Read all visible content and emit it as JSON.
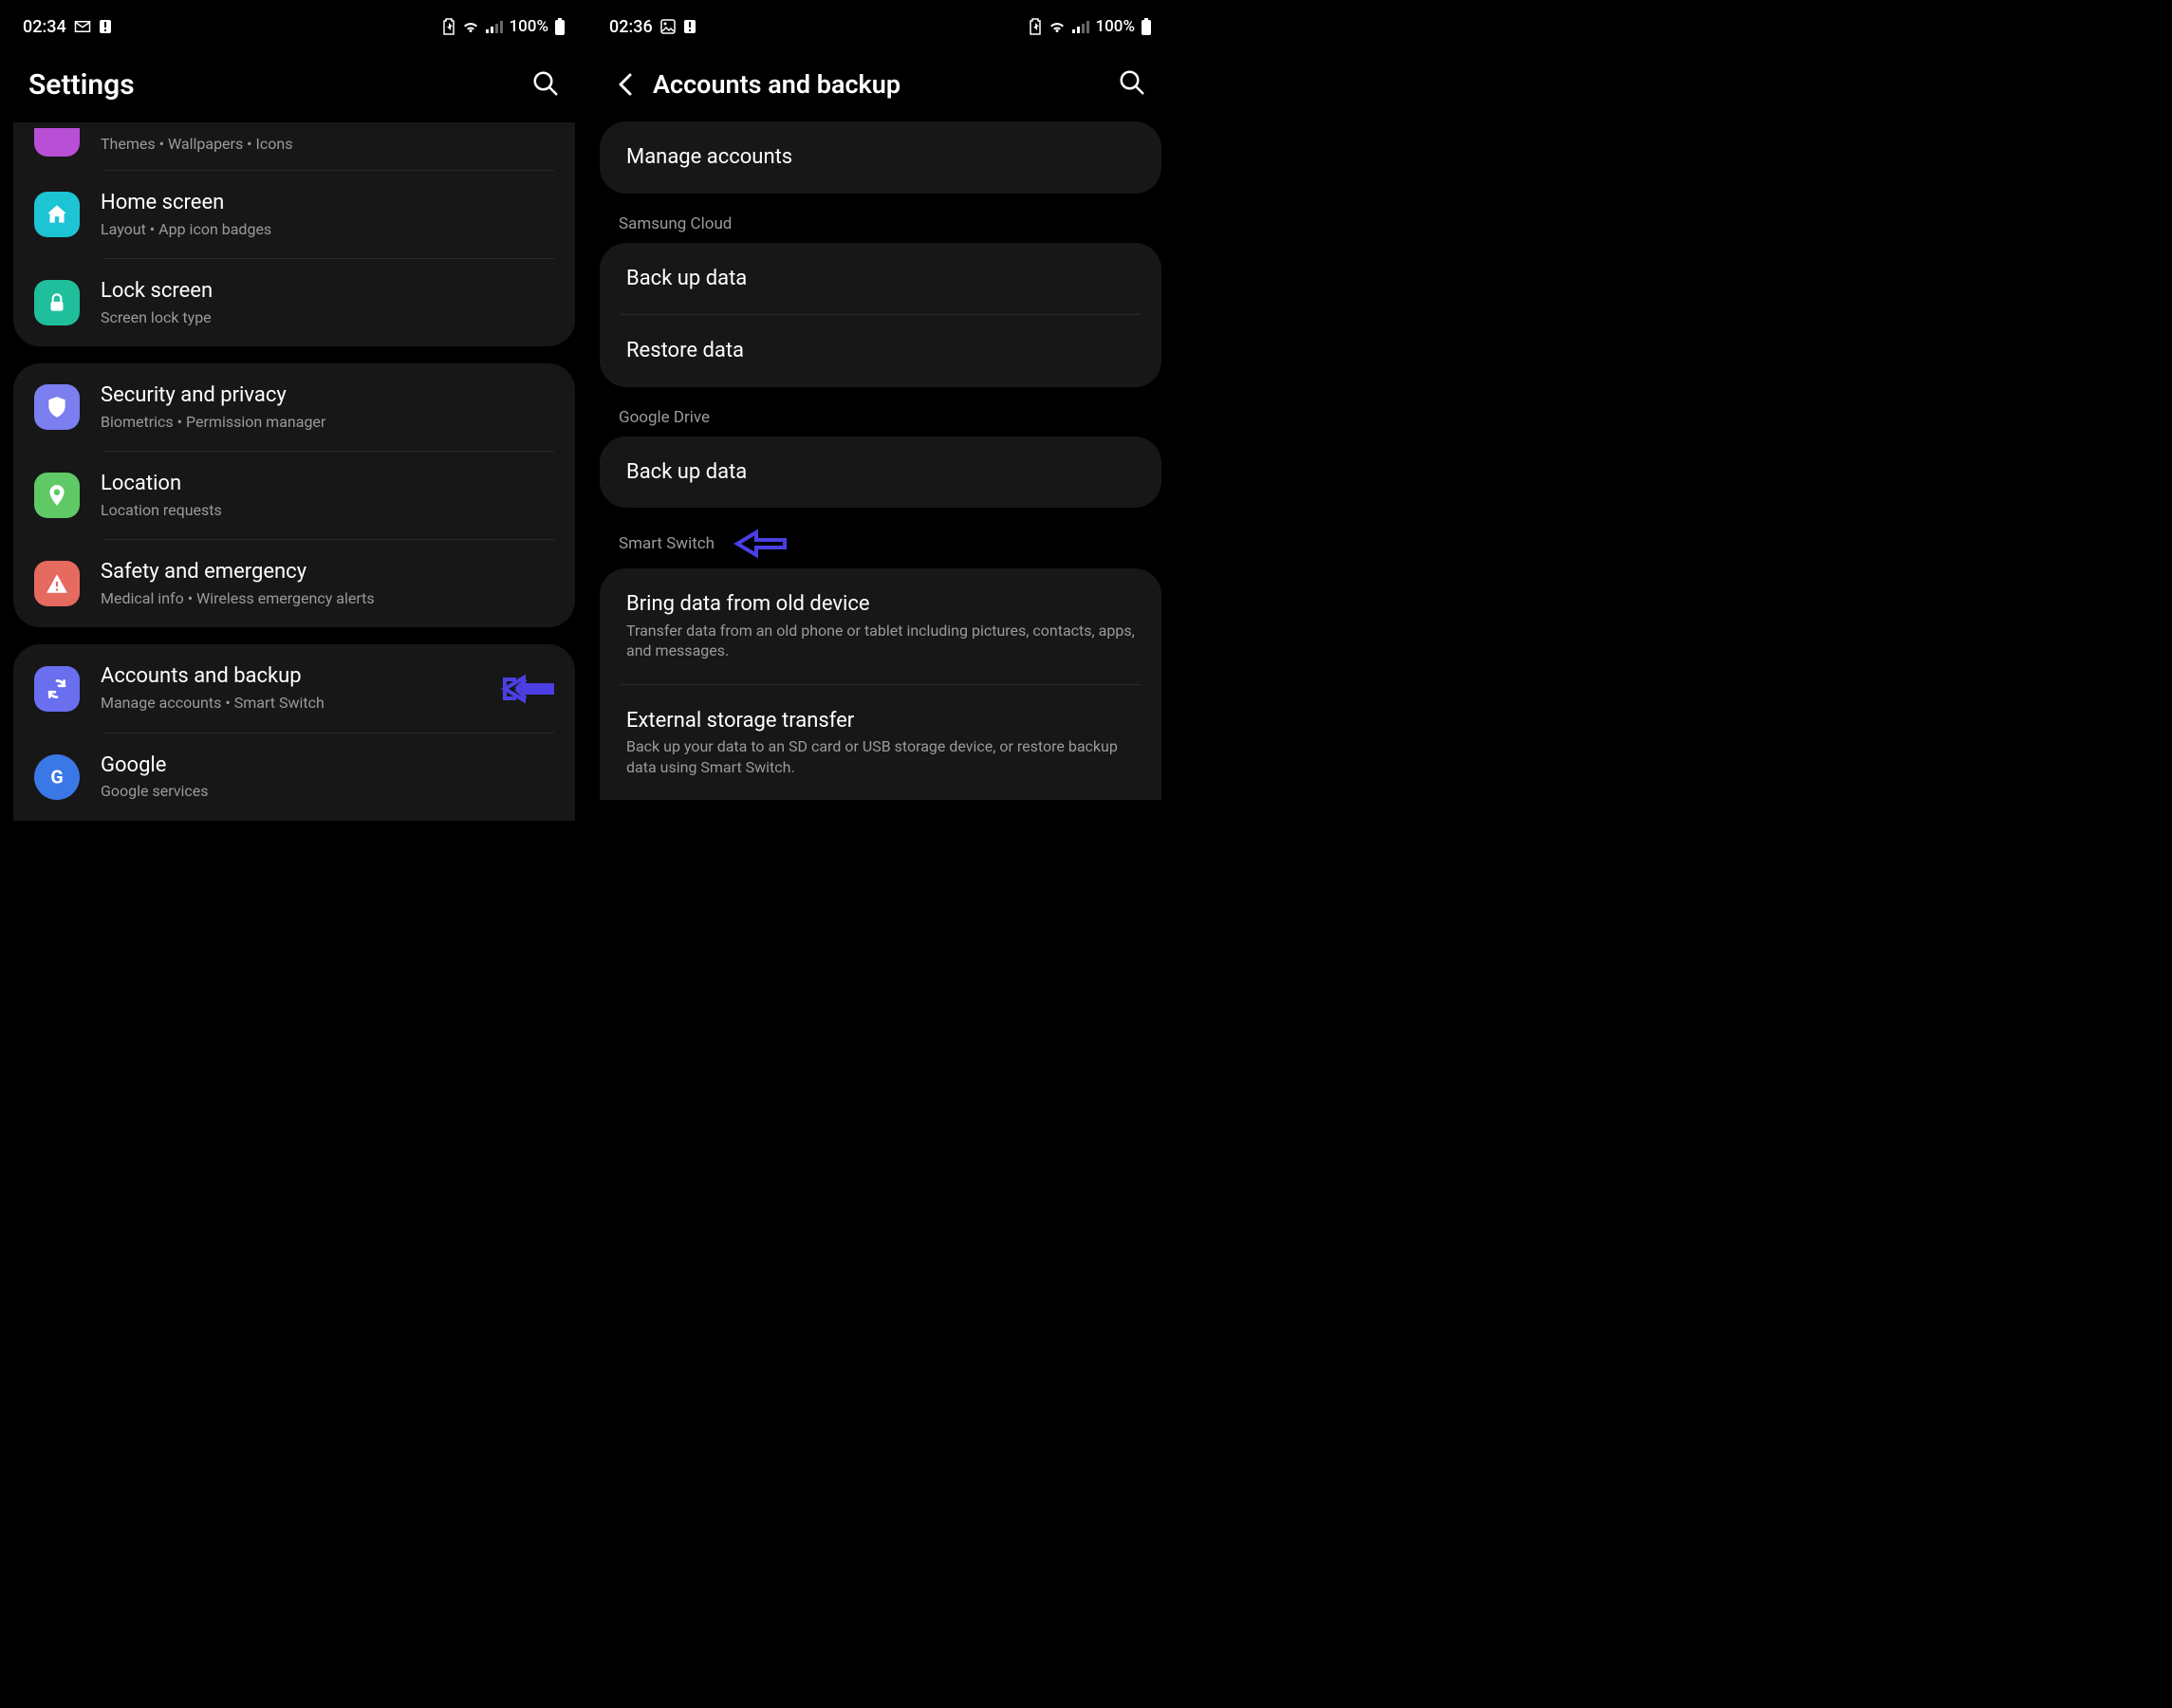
{
  "left": {
    "status": {
      "time": "02:34",
      "battery_pct": "100%"
    },
    "header": {
      "title": "Settings"
    },
    "icon_colors": {
      "themes": "#b84fd6",
      "home": "#1cc4d4",
      "lock": "#1fbf9c",
      "security": "#7b7ff0",
      "location": "#5fc965",
      "safety": "#e66a5f",
      "accounts": "#6a6ff0",
      "google": "#3b78e7"
    },
    "group0": {
      "themes": {
        "sub": "Themes  •  Wallpapers  •  Icons"
      },
      "home": {
        "title": "Home screen",
        "sub": "Layout  •  App icon badges"
      },
      "lock": {
        "title": "Lock screen",
        "sub": "Screen lock type"
      }
    },
    "group1": {
      "security": {
        "title": "Security and privacy",
        "sub": "Biometrics  •  Permission manager"
      },
      "location": {
        "title": "Location",
        "sub": "Location requests"
      },
      "safety": {
        "title": "Safety and emergency",
        "sub": "Medical info  •  Wireless emergency alerts"
      }
    },
    "group2": {
      "accounts": {
        "title": "Accounts and backup",
        "sub": "Manage accounts  •  Smart Switch"
      },
      "google": {
        "title": "Google",
        "sub": "Google services"
      }
    }
  },
  "right": {
    "status": {
      "time": "02:36",
      "battery_pct": "100%"
    },
    "header": {
      "title": "Accounts and backup"
    },
    "manage": {
      "title": "Manage accounts"
    },
    "sections": {
      "samsung": {
        "label": "Samsung Cloud",
        "backup": "Back up data",
        "restore": "Restore data"
      },
      "gdrive": {
        "label": "Google Drive",
        "backup": "Back up data"
      },
      "smartswitch": {
        "label": "Smart Switch",
        "bring": {
          "title": "Bring data from old device",
          "sub": "Transfer data from an old phone or tablet including pictures, contacts, apps, and messages."
        },
        "external": {
          "title": "External storage transfer",
          "sub": "Back up your data to an SD card or USB storage device, or restore backup data using Smart Switch."
        }
      }
    }
  },
  "arrow_color": "#4b3fe4"
}
